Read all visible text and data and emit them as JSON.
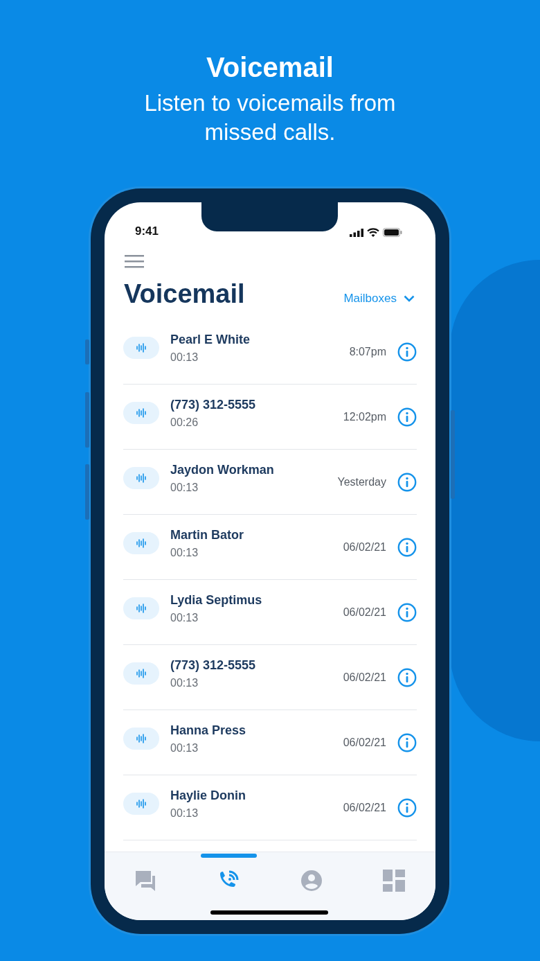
{
  "header": {
    "title": "Voicemail",
    "subtitle": "Listen to voicemails from missed calls."
  },
  "status_bar": {
    "time": "9:41"
  },
  "screen": {
    "title": "Voicemail",
    "mailboxes": "Mailboxes"
  },
  "voicemails": [
    {
      "name": "Pearl E White",
      "duration": "00:13",
      "time": "8:07pm"
    },
    {
      "name": "(773) 312-5555",
      "duration": "00:26",
      "time": "12:02pm"
    },
    {
      "name": "Jaydon Workman",
      "duration": "00:13",
      "time": "Yesterday"
    },
    {
      "name": "Martin Bator",
      "duration": "00:13",
      "time": "06/02/21"
    },
    {
      "name": "Lydia Septimus",
      "duration": "00:13",
      "time": "06/02/21"
    },
    {
      "name": "(773) 312-5555",
      "duration": "00:13",
      "time": "06/02/21"
    },
    {
      "name": "Hanna Press",
      "duration": "00:13",
      "time": "06/02/21"
    },
    {
      "name": "Haylie Donin",
      "duration": "00:13",
      "time": "06/02/21"
    }
  ],
  "tabs": [
    {
      "kind": "messages",
      "selected": false
    },
    {
      "kind": "calls",
      "selected": true
    },
    {
      "kind": "contacts",
      "selected": false
    },
    {
      "kind": "dashboard",
      "selected": false
    }
  ]
}
